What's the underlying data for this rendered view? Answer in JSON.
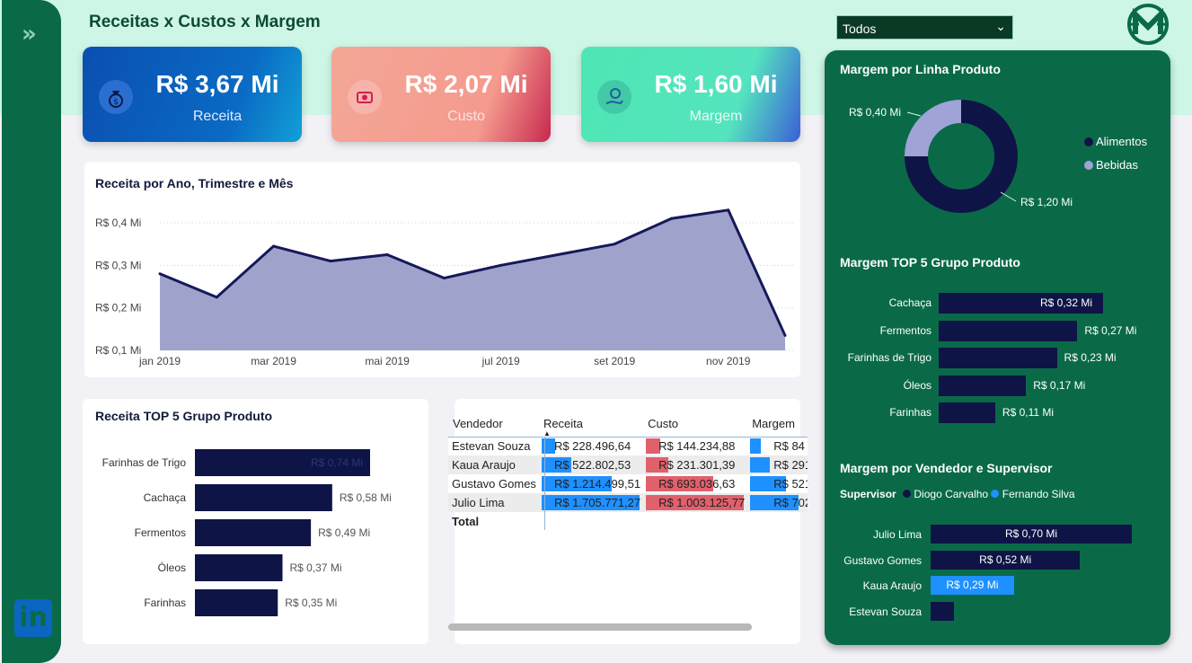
{
  "page": {
    "title": "Receitas x Custos x Margem",
    "filter_value": "Todos",
    "icons": {
      "expand": "double-chevron-right-icon",
      "linkedin": "linkedin-icon",
      "logo": "brand-logo-icon",
      "dropdown": "chevron-down-icon"
    }
  },
  "kpis": [
    {
      "value": "R$ 3,67 Mi",
      "label": "Receita",
      "icon": "money-bag-icon"
    },
    {
      "value": "R$ 2,07 Mi",
      "label": "Custo",
      "icon": "money-icon"
    },
    {
      "value": "R$ 1,60 Mi",
      "label": "Margem",
      "icon": "dollar-hand-icon"
    }
  ],
  "line_chart": {
    "title": "Receita por Ano, Trimestre e Mês",
    "yticks": [
      "R$ 0,4 Mi",
      "R$ 0,3 Mi",
      "R$ 0,2 Mi",
      "R$ 0,1 Mi"
    ],
    "xticks": [
      "jan 2019",
      "mar 2019",
      "mai 2019",
      "jul 2019",
      "set 2019",
      "nov 2019"
    ]
  },
  "bar_left": {
    "title": "Receita TOP 5 Grupo Produto",
    "items": [
      {
        "label": "Farinhas de Trigo",
        "value_label": "R$ 0,74 Mi"
      },
      {
        "label": "Cachaça",
        "value_label": "R$ 0,58 Mi"
      },
      {
        "label": "Fermentos",
        "value_label": "R$ 0,49 Mi"
      },
      {
        "label": "Óleos",
        "value_label": "R$ 0,37 Mi"
      },
      {
        "label": "Farinhas",
        "value_label": "R$ 0,35 Mi"
      }
    ]
  },
  "table": {
    "headers": [
      "Vendedor",
      "Receita",
      "Custo",
      "Margem"
    ],
    "rows": [
      {
        "vendedor": "Estevan Souza",
        "receita": "R$ 228.496,64",
        "custo": "R$ 144.234,88",
        "margem": "R$ 84",
        "receita_frac": 0.134,
        "custo_frac": 0.144,
        "margem_frac": 0.12
      },
      {
        "vendedor": "Kaua Araujo",
        "receita": "R$ 522.802,53",
        "custo": "R$ 231.301,39",
        "margem": "R$ 291",
        "receita_frac": 0.306,
        "custo_frac": 0.231,
        "margem_frac": 0.41
      },
      {
        "vendedor": "Gustavo Gomes",
        "receita": "R$ 1.214.499,51",
        "custo": "R$ 693.036,63",
        "margem": "R$ 521",
        "receita_frac": 0.712,
        "custo_frac": 0.691,
        "margem_frac": 0.74
      },
      {
        "vendedor": "Julio Lima",
        "receita": "R$ 1.705.771,27",
        "custo": "R$ 1.003.125,77",
        "margem": "R$ 702",
        "receita_frac": 1.0,
        "custo_frac": 1.0,
        "margem_frac": 1.0
      }
    ],
    "total_label": "Total"
  },
  "donut": {
    "title": "Margem por Linha Produto",
    "legend": [
      "Alimentos",
      "Bebidas"
    ],
    "labels": [
      "R$ 0,40 Mi",
      "R$ 1,20 Mi"
    ]
  },
  "top5_margin": {
    "title": "Margem TOP 5 Grupo Produto",
    "items": [
      {
        "label": "Cachaça",
        "value_label": "R$ 0,32 Mi"
      },
      {
        "label": "Fermentos",
        "value_label": "R$ 0,27 Mi"
      },
      {
        "label": "Farinhas de Trigo",
        "value_label": "R$ 0,23 Mi"
      },
      {
        "label": "Óleos",
        "value_label": "R$ 0,17 Mi"
      },
      {
        "label": "Farinhas",
        "value_label": "R$ 0,11 Mi"
      }
    ]
  },
  "seller_margin": {
    "title": "Margem por Vendedor e Supervisor",
    "legend_title": "Supervisor",
    "legend": [
      "Diogo Carvalho",
      "Fernando Silva"
    ],
    "items": [
      {
        "label": "Julio Lima",
        "value_label": "R$ 0,70 Mi"
      },
      {
        "label": "Gustavo Gomes",
        "value_label": "R$ 0,52 Mi"
      },
      {
        "label": "Kaua Araujo",
        "value_label": "R$ 0,29 Mi"
      },
      {
        "label": "Estevan Souza",
        "value_label": ""
      }
    ]
  },
  "colors": {
    "navy": "#0f1446",
    "green": "#0a6a48",
    "blue_bar": "#1e90ff",
    "red_bar": "#e0606c",
    "area": "#9fa3cc"
  },
  "chart_data": [
    {
      "type": "area",
      "title": "Receita por Ano, Trimestre e Mês",
      "x": [
        "jan 2019",
        "fev 2019",
        "mar 2019",
        "abr 2019",
        "mai 2019",
        "jun 2019",
        "jul 2019",
        "ago 2019",
        "set 2019",
        "out 2019",
        "nov 2019",
        "dez 2019"
      ],
      "values": [
        0.28,
        0.225,
        0.345,
        0.31,
        0.325,
        0.27,
        0.3,
        0.325,
        0.35,
        0.41,
        0.43,
        0.135
      ],
      "ylim": [
        0.1,
        0.45
      ],
      "grid": true
    },
    {
      "type": "bar",
      "title": "Receita TOP 5 Grupo Produto",
      "categories": [
        "Farinhas de Trigo",
        "Cachaça",
        "Fermentos",
        "Óleos",
        "Farinhas"
      ],
      "values": [
        0.74,
        0.58,
        0.49,
        0.37,
        0.35
      ]
    },
    {
      "type": "pie",
      "title": "Margem por Linha Produto",
      "categories": [
        "Alimentos",
        "Bebidas"
      ],
      "values": [
        1.2,
        0.4
      ]
    },
    {
      "type": "bar",
      "title": "Margem TOP 5 Grupo Produto",
      "categories": [
        "Cachaça",
        "Fermentos",
        "Farinhas de Trigo",
        "Óleos",
        "Farinhas"
      ],
      "values": [
        0.32,
        0.27,
        0.23,
        0.17,
        0.11
      ]
    },
    {
      "type": "bar",
      "title": "Margem por Vendedor e Supervisor",
      "categories": [
        "Julio Lima",
        "Gustavo Gomes",
        "Kaua Araujo",
        "Estevan Souza"
      ],
      "values": [
        0.7,
        0.52,
        0.29,
        0.08
      ],
      "supervisor": [
        "Diogo Carvalho",
        "Diogo Carvalho",
        "Fernando Silva",
        "Diogo Carvalho"
      ]
    }
  ]
}
